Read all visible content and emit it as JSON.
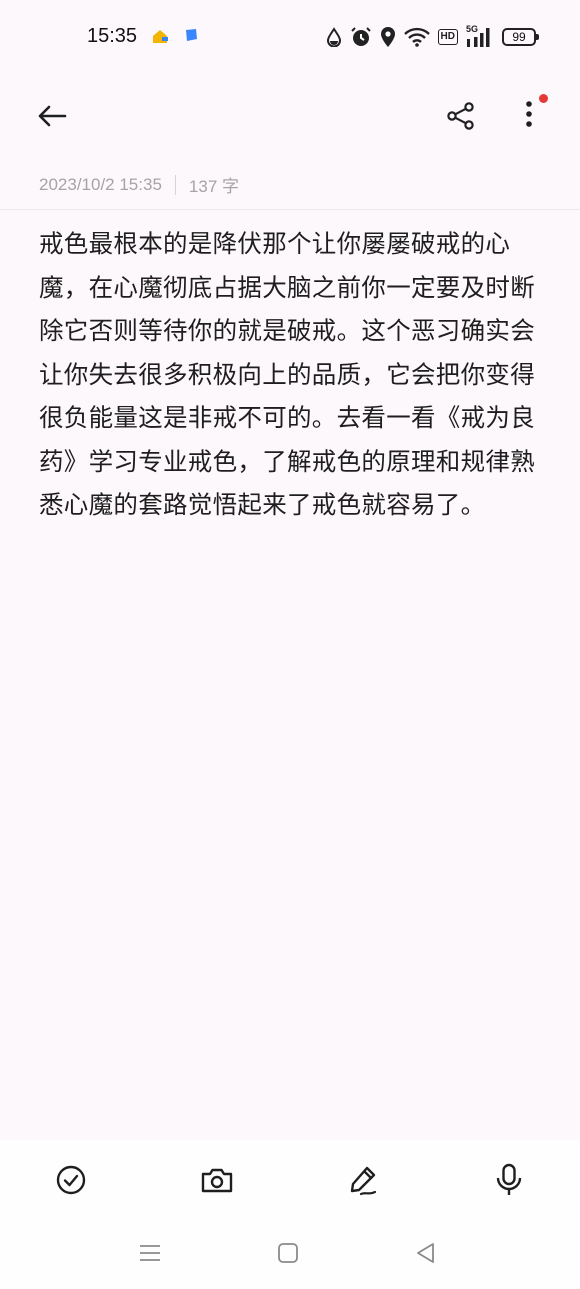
{
  "status_bar": {
    "time": "15:35",
    "network_label": "5G",
    "hd_label": "HD",
    "battery_level": "99"
  },
  "toolbar": {
    "back_icon": "arrow-left-icon",
    "share_icon": "share-icon",
    "more_icon": "more-vertical-icon",
    "notification_dot_color": "#e53935"
  },
  "note": {
    "date": "2023/10/2 15:35",
    "word_count": "137 字",
    "content": "戒色最根本的是降伏那个让你屡屡破戒的心魔，在心魔彻底占据大脑之前你一定要及时断除它否则等待你的就是破戒。这个恶习确实会让你失去很多积极向上的品质，它会把你变得很负能量这是非戒不可的。去看一看《戒为良药》学习专业戒色，了解戒色的原理和规律熟悉心魔的套路觉悟起来了戒色就容易了。"
  },
  "bottom_tools": [
    {
      "icon": "checklist-icon"
    },
    {
      "icon": "camera-icon"
    },
    {
      "icon": "pen-icon"
    },
    {
      "icon": "microphone-icon"
    }
  ],
  "nav": {
    "menu_icon": "menu-icon",
    "home_icon": "home-square-icon",
    "back_icon": "back-triangle-icon"
  },
  "colors": {
    "background": "#fdf8fc",
    "meta_text": "#a6a3a6",
    "accent_dot": "#e53935"
  }
}
